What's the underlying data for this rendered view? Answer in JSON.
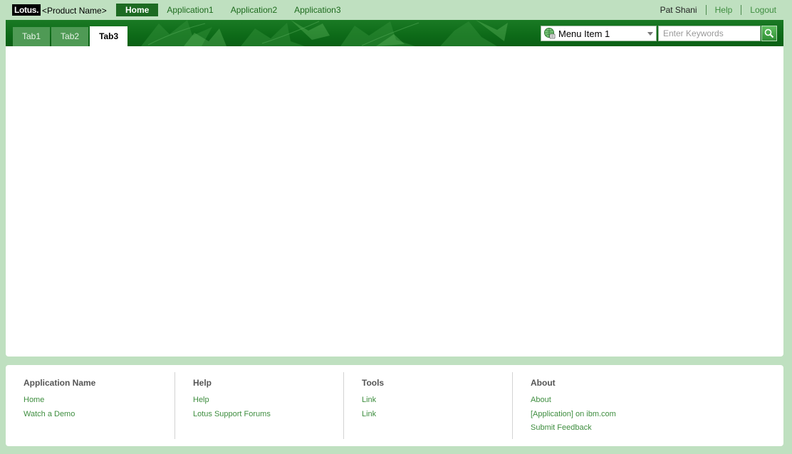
{
  "banner": {
    "logo": "Lotus.",
    "product_name": "<Product Name>",
    "nav": [
      {
        "label": "Home",
        "active": true
      },
      {
        "label": "Application1",
        "active": false
      },
      {
        "label": "Application2",
        "active": false
      },
      {
        "label": "Application3",
        "active": false
      }
    ],
    "user_name": "Pat Shani",
    "help_label": "Help",
    "logout_label": "Logout"
  },
  "titlebar": {
    "tabs": [
      {
        "label": "Tab1",
        "active": false
      },
      {
        "label": "Tab2",
        "active": false
      },
      {
        "label": "Tab3",
        "active": true
      }
    ],
    "scope_selected": "Menu Item 1",
    "search_placeholder": "Enter Keywords",
    "search_value": ""
  },
  "footer": {
    "columns": [
      {
        "heading": "Application Name",
        "links": [
          "Home",
          "Watch a Demo"
        ]
      },
      {
        "heading": "Help",
        "links": [
          "Help",
          "Lotus Support Forums"
        ]
      },
      {
        "heading": "Tools",
        "links": [
          "Link",
          "Link"
        ]
      },
      {
        "heading": "About",
        "links": [
          "About",
          "[Application] on ibm.com",
          "Submit Feedback"
        ]
      }
    ]
  },
  "colors": {
    "page_bg": "#bfe0c0",
    "titlebar_green": "#0d6a18",
    "active_nav": "#1d6a22",
    "link_green": "#3e8d3f",
    "tab_inactive": "#4f9a55"
  },
  "icons": {
    "scope": "globe-icon",
    "search": "search-icon",
    "scope_caret": "chevron-down-icon"
  }
}
